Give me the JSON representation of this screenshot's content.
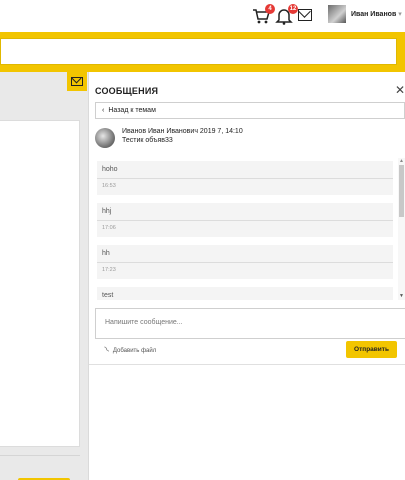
{
  "header": {
    "cart_badge": "4",
    "notifications_badge": "12",
    "user_name": "Иван Иванов",
    "user_caret": "▾"
  },
  "messages_panel": {
    "title": "СООБЩЕНИЯ",
    "close_glyph": "✕",
    "back_label": "Назад к темам",
    "back_glyph": "‹",
    "thread": {
      "author_line": "Иванов Иван Иванович 2019 7, 14:10",
      "subject": "Тестик объяв33"
    },
    "messages": [
      {
        "text": "hoho",
        "time": "16:53"
      },
      {
        "text": "hhj",
        "time": "17:06"
      },
      {
        "text": "hh",
        "time": "17:23"
      },
      {
        "text": "test",
        "time": ""
      }
    ],
    "composer_placeholder": "Напишите сообщение...",
    "attach_label": "Добавить файл",
    "send_label": "Отправить"
  },
  "colors": {
    "accent": "#f2c500",
    "badge": "#e53935"
  },
  "icons": [
    "cart-icon",
    "bell-icon",
    "mail-icon",
    "paperclip-icon",
    "close-icon",
    "chevron-left-icon"
  ]
}
